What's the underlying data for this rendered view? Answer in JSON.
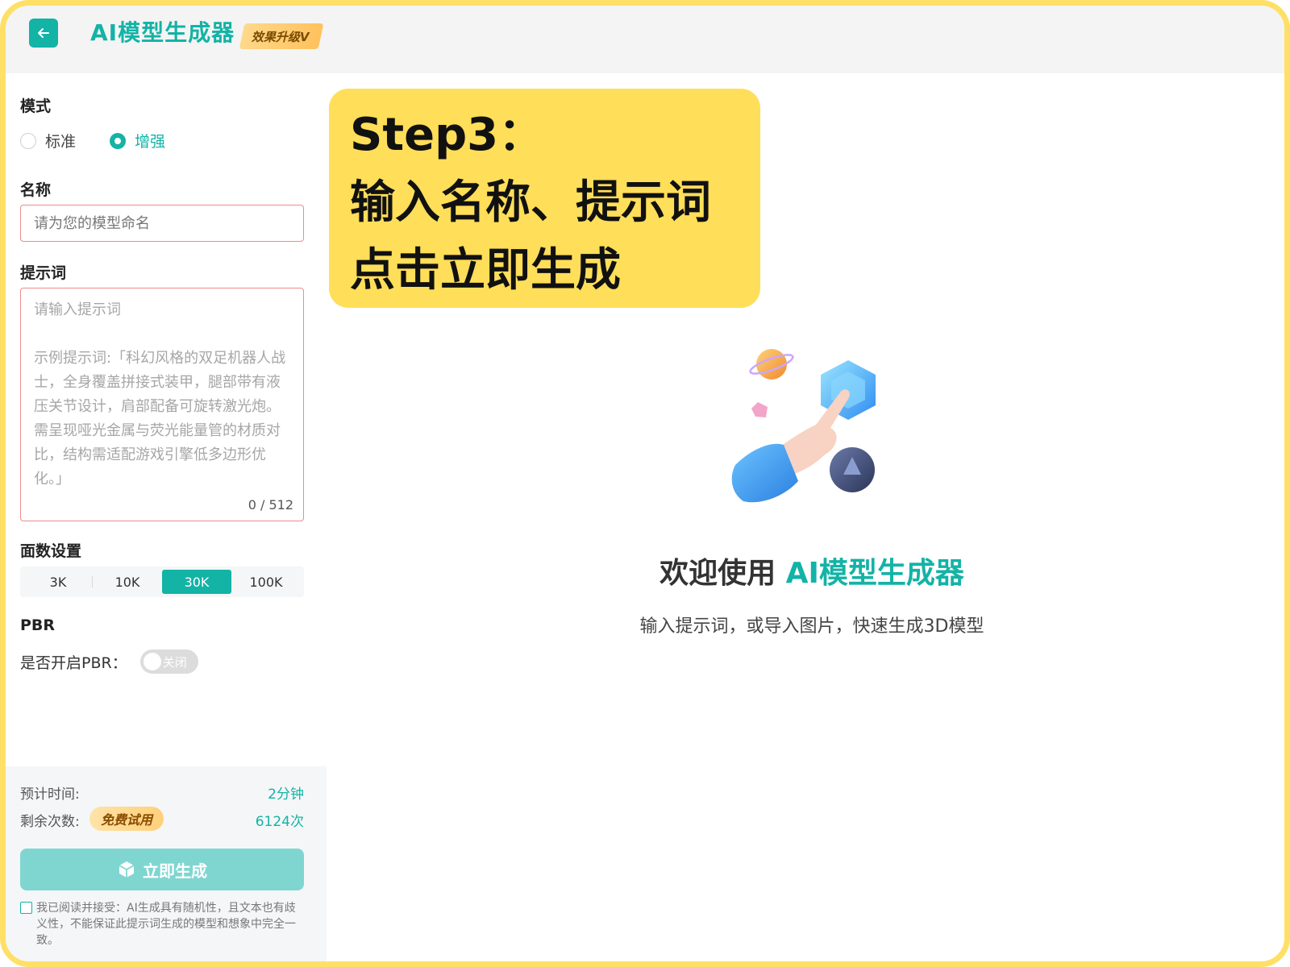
{
  "header": {
    "title": "AI模型生成器",
    "badge": "效果升级V"
  },
  "sidebar": {
    "mode": {
      "label": "模式",
      "options": [
        {
          "label": "标准",
          "selected": false
        },
        {
          "label": "增强",
          "selected": true
        }
      ]
    },
    "name": {
      "label": "名称",
      "placeholder": "请为您的模型命名",
      "value": ""
    },
    "prompt": {
      "label": "提示词",
      "placeholder": "请输入提示词",
      "example": "示例提示词:「科幻风格的双足机器人战士，全身覆盖拼接式装甲，腿部带有液压关节设计，肩部配备可旋转激光炮。需呈现哑光金属与荧光能量管的材质对比，结构需适配游戏引擎低多边形优化。」",
      "count": "0 / 512"
    },
    "faces": {
      "label": "面数设置",
      "options": [
        "3K",
        "10K",
        "30K",
        "100K"
      ],
      "selected": "30K"
    },
    "pbr": {
      "label": "PBR",
      "toggle_label": "是否开启PBR：",
      "toggle_text": "关闭",
      "enabled": false
    },
    "bottom": {
      "est_time_label": "预计时间:",
      "est_time_value": "2分钟",
      "remaining_label": "剩余次数:",
      "trial_badge": "免费试用",
      "remaining_value": "6124次",
      "generate_label": "立即生成",
      "agreement": "我已阅读并接受：AI生成具有随机性，且文本也有歧义性，不能保证此提示词生成的模型和想象中完全一致。"
    }
  },
  "step": {
    "line1": "Step3：",
    "line2": "输入名称、提示词",
    "line3": "点击立即生成"
  },
  "main": {
    "welcome_prefix": "欢迎使用 ",
    "welcome_brand": "AI模型生成器",
    "subtitle": "输入提示词，或导入图片，快速生成3D模型"
  },
  "colors": {
    "accent": "#13b3a6",
    "callout": "#ffde59",
    "frame": "#ffe066"
  }
}
